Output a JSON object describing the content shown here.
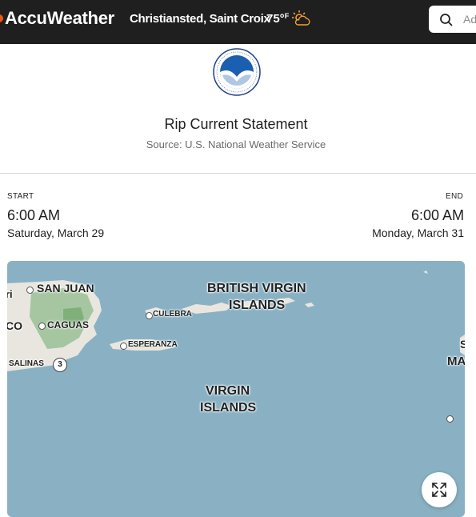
{
  "header": {
    "brand": "AccuWeather",
    "location": "Christiansted, Saint Croix",
    "temperature": "75°",
    "temperature_unit": "F",
    "weather_icon": "partly-sunny-icon",
    "search_placeholder": "Ad"
  },
  "alert": {
    "logo": "noaa-logo",
    "title": "Rip Current Statement",
    "source": "Source: U.S. National Weather Service"
  },
  "timing": {
    "start_label": "START",
    "start_time": "6:00 AM",
    "start_date": "Saturday, March 29",
    "end_label": "END",
    "end_time": "6:00 AM",
    "end_date": "Monday, March 31"
  },
  "map": {
    "labels": {
      "san_juan": "SAN JUAN",
      "caguas": "CAGUAS",
      "salinas": "SALINAS",
      "route": "3",
      "culebra": "CULEBRA",
      "esperanza": "ESPERANZA",
      "bvi_line1": "BRITISH VIRGIN",
      "bvi_line2": "ISLANDS",
      "vi_line1": "VIRGIN",
      "vi_line2": "ISLANDS",
      "edge_left_top": "ri",
      "edge_left": "CO",
      "edge_right": "MA",
      "edge_right_top": "S"
    },
    "expand_icon": "expand-icon",
    "colors": {
      "water": "#89b1c3",
      "land": "#e9e6df",
      "forest": "#9fc29a"
    }
  }
}
